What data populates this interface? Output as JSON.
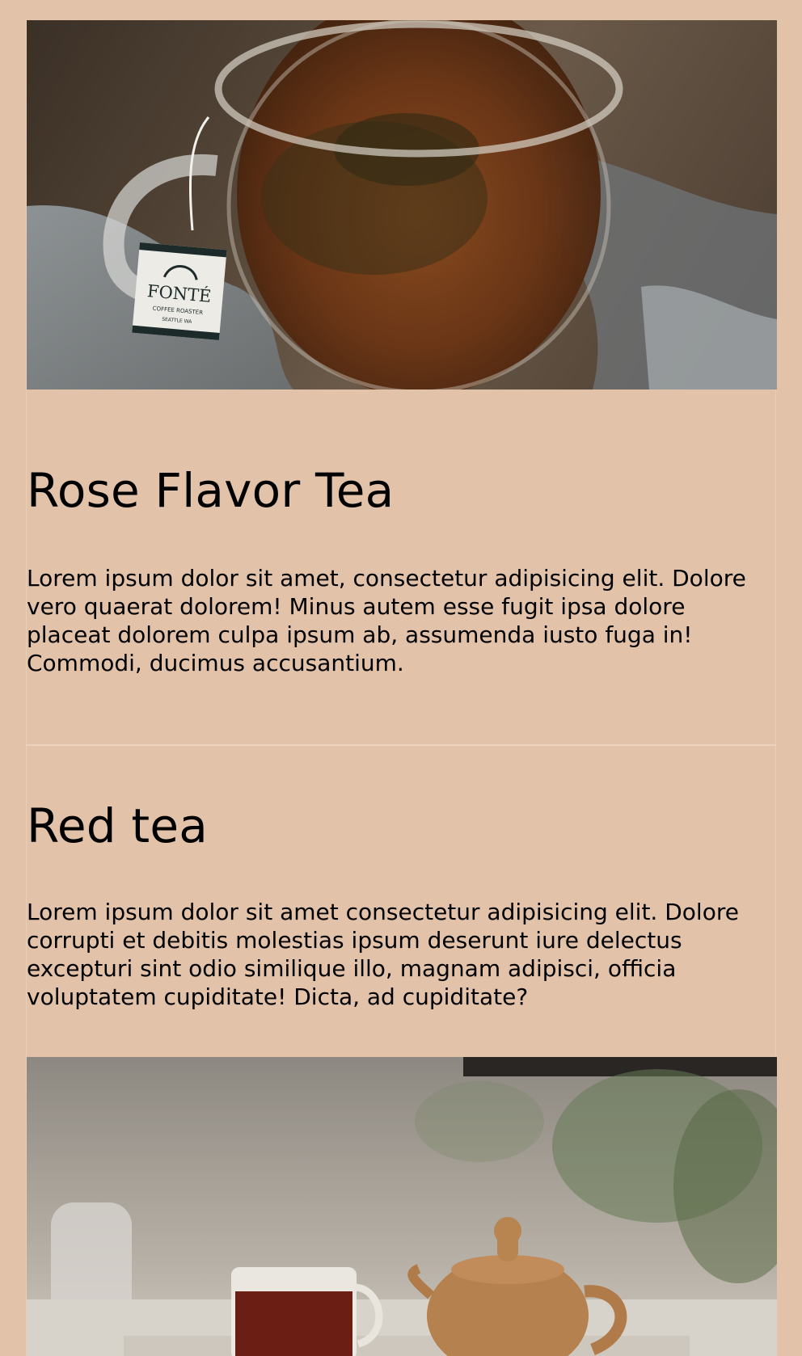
{
  "articles": [
    {
      "title": "Rose Flavor Tea",
      "body": "Lorem ipsum dolor sit amet, consectetur adipisicing elit. Dolore vero quaerat dolorem! Minus autem esse fugit ipsa dolore placeat dolorem culpa ipsum ab, assumenda iusto fuga in! Commodi, ducimus accusantium.",
      "image": {
        "tag_brand": "FONTÉ",
        "tag_line1": "COFFEE ROASTER",
        "tag_line2": "SEATTLE WA"
      }
    },
    {
      "title": "Red tea",
      "body": "Lorem ipsum dolor sit amet consectetur adipisicing elit. Dolore corrupti et debitis molestias ipsum deserunt iure delectus excepturi sint odio similique illo, magnam adipisci, officia voluptatem cupiditate! Dicta, ad cupiditate?"
    }
  ],
  "colors": {
    "background": "#e3c2aa",
    "text": "#000000"
  }
}
